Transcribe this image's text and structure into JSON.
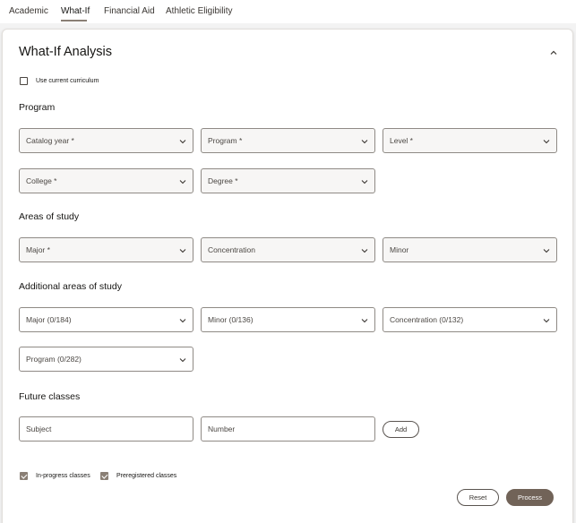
{
  "tabs": [
    {
      "label": "Academic"
    },
    {
      "label": "What-If"
    },
    {
      "label": "Financial Aid"
    },
    {
      "label": "Athletic Eligibility"
    }
  ],
  "panel": {
    "title": "What-If Analysis",
    "collapse_icon": "chevron-up-icon"
  },
  "use_current_curriculum": {
    "label": "Use current curriculum",
    "checked": false
  },
  "program_section": {
    "title": "Program",
    "fields": [
      {
        "label": "Catalog year *"
      },
      {
        "label": "Program *"
      },
      {
        "label": "Level *"
      },
      {
        "label": "College *"
      },
      {
        "label": "Degree *"
      }
    ]
  },
  "areas_section": {
    "title": "Areas of study",
    "fields": [
      {
        "label": "Major *"
      },
      {
        "label": "Concentration"
      },
      {
        "label": "Minor"
      }
    ]
  },
  "additional_section": {
    "title": "Additional areas of study",
    "fields": [
      {
        "label": "Major (0/184)"
      },
      {
        "label": "Minor (0/136)"
      },
      {
        "label": "Concentration (0/132)"
      },
      {
        "label": "Program (0/282)"
      }
    ]
  },
  "future_section": {
    "title": "Future classes",
    "subject_placeholder": "Subject",
    "number_placeholder": "Number",
    "add_label": "Add"
  },
  "options": {
    "in_progress": {
      "label": "In-progress classes",
      "checked": true
    },
    "preregistered": {
      "label": "Preregistered classes",
      "checked": true
    }
  },
  "actions": {
    "reset_label": "Reset",
    "process_label": "Process"
  },
  "colors": {
    "accent": "#716358",
    "checkbox": "#8a7f75",
    "field_border": "#8f8a85"
  }
}
